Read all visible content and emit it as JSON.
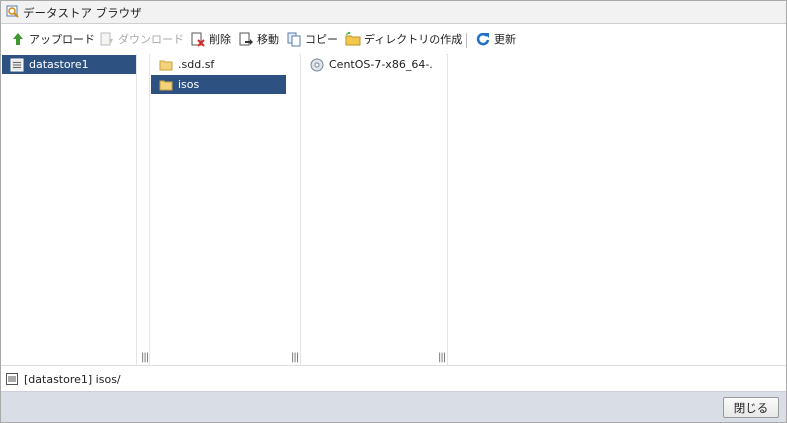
{
  "window": {
    "title": "データストア ブラウザ"
  },
  "toolbar": {
    "upload": "アップロード",
    "download": "ダウンロード",
    "delete": "削除",
    "move": "移動",
    "copy": "コピー",
    "mkdir": "ディレクトリの作成",
    "refresh": "更新"
  },
  "columns": {
    "datastores": [
      "datastore1"
    ],
    "folders": [
      ".sdd.sf",
      "isos"
    ],
    "files": [
      "CentOS-7-x86_64-..."
    ]
  },
  "status": {
    "path": "[datastore1] isos/"
  },
  "footer": {
    "close": "閉じる"
  }
}
